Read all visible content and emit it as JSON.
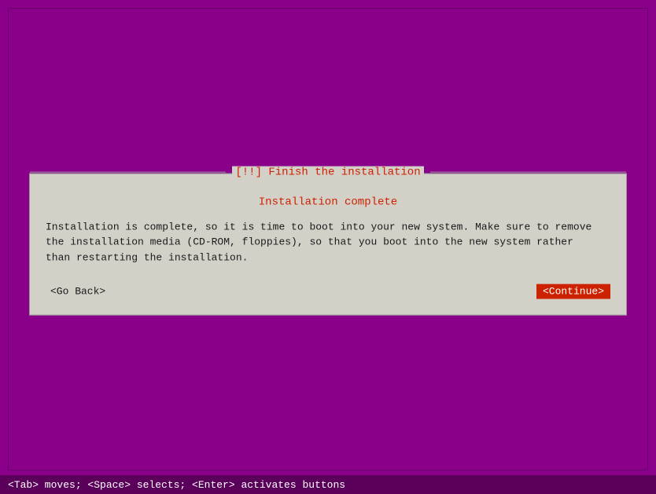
{
  "background_color": "#8b008b",
  "outer_border_color": "#6a006a",
  "dialog": {
    "title": "[!!] Finish the installation",
    "title_color": "#cc2200",
    "background_color": "#d3d0c8",
    "installation_complete_label": "Installation complete",
    "message_line1": "Installation is complete, so it is time to boot into your new system. Make sure to remove",
    "message_line2": "the installation media (CD-ROM, floppies), so that you boot into the new system rather",
    "message_line3": "than restarting the installation.",
    "message_full": "Installation is complete, so it is time to boot into your new system. Make sure to remove\nthe installation media (CD-ROM, floppies), so that you boot into the new system rather\nthan restarting the installation.",
    "btn_go_back_label": "<Go Back>",
    "btn_continue_label": "<Continue>"
  },
  "status_bar": {
    "text": "<Tab> moves; <Space> selects; <Enter> activates buttons"
  }
}
